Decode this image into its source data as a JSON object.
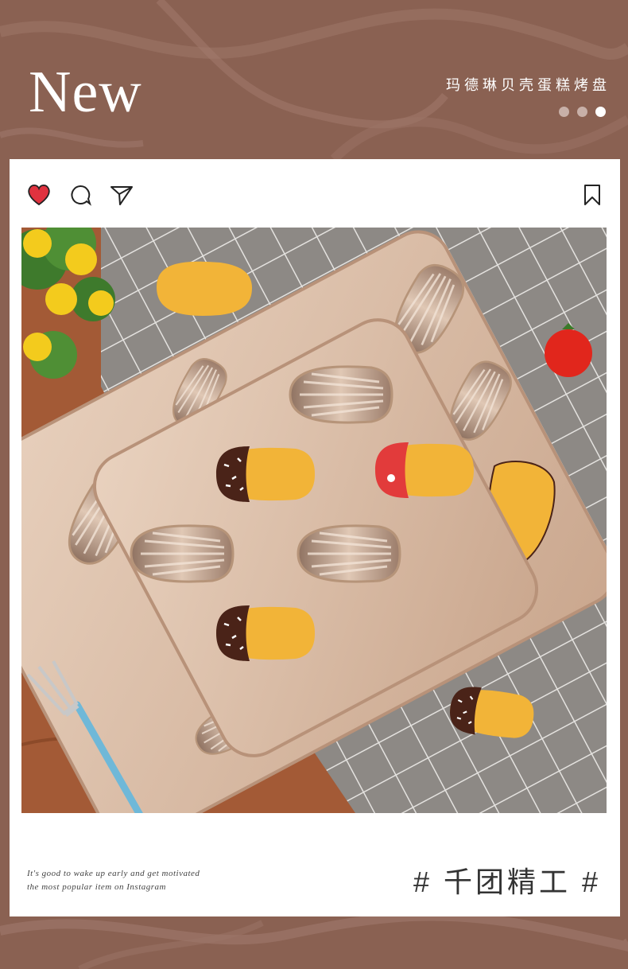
{
  "header": {
    "title": "New",
    "subtitle": "玛德琳贝壳蛋糕烤盘",
    "carousel": {
      "dot_count": 3,
      "active_index": 2
    }
  },
  "post": {
    "actions": [
      "heart-icon",
      "comment-icon",
      "send-icon"
    ],
    "bookmark": "bookmark-icon",
    "caption_line1": "It's good to wake up early and get motivated",
    "caption_line2": "the most popular item on Instagram",
    "tag": "# 千团精工 #"
  },
  "colors": {
    "background": "#8a6152",
    "heart": "#e0323f",
    "tray": "#d9bca4"
  }
}
